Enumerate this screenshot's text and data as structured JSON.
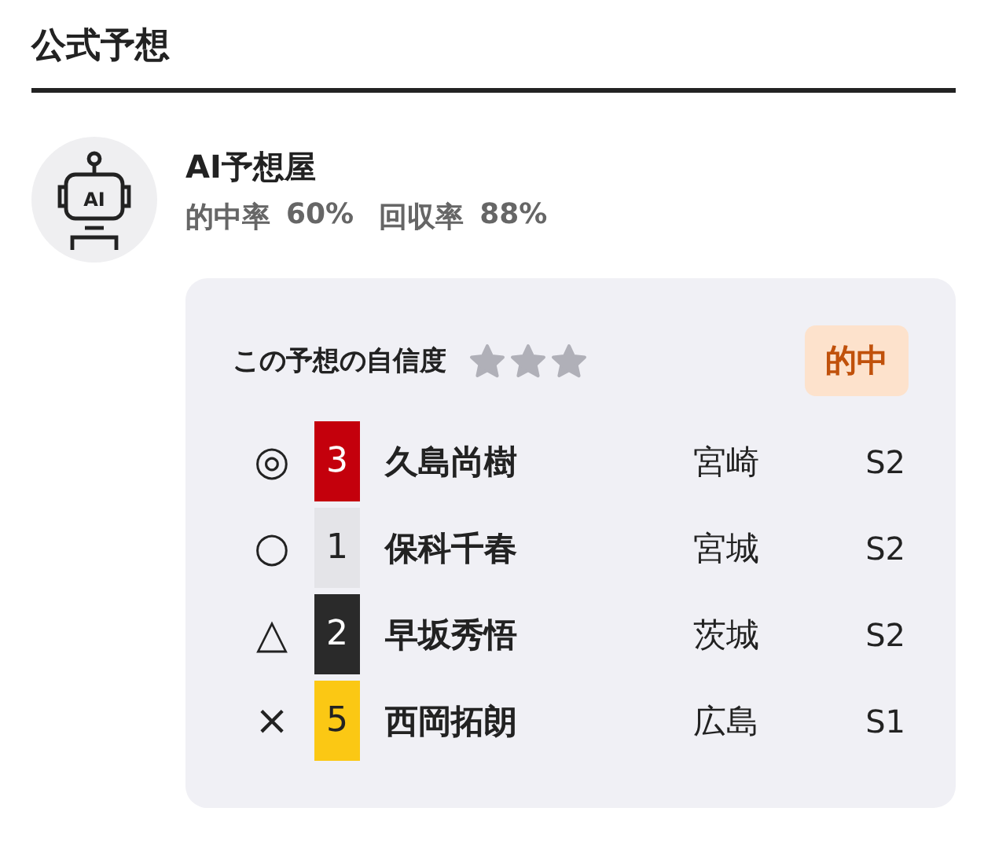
{
  "section_title": "公式予想",
  "predictor": {
    "avatar_text": "AI",
    "name": "AI予想屋",
    "stats": [
      {
        "label": "的中率",
        "value": "60%"
      },
      {
        "label": "回収率",
        "value": "88%"
      }
    ]
  },
  "prediction": {
    "confidence_label": "この予想の自信度",
    "stars": 0,
    "result_badge": "的中",
    "picks": [
      {
        "mark": "◎",
        "number": "3",
        "color": "#c4000c",
        "name": "久島尚樹",
        "prefecture": "宮崎",
        "class": "S2"
      },
      {
        "mark": "○",
        "number": "1",
        "color": "#e4e4e8",
        "name": "保科千春",
        "prefecture": "宮城",
        "class": "S2"
      },
      {
        "mark": "△",
        "number": "2",
        "color": "#2a2a2a",
        "name": "早坂秀悟",
        "prefecture": "茨城",
        "class": "S2"
      },
      {
        "mark": "×",
        "number": "5",
        "color": "#fbc814",
        "name": "西岡拓朗",
        "prefecture": "広島",
        "class": "S1"
      }
    ]
  }
}
